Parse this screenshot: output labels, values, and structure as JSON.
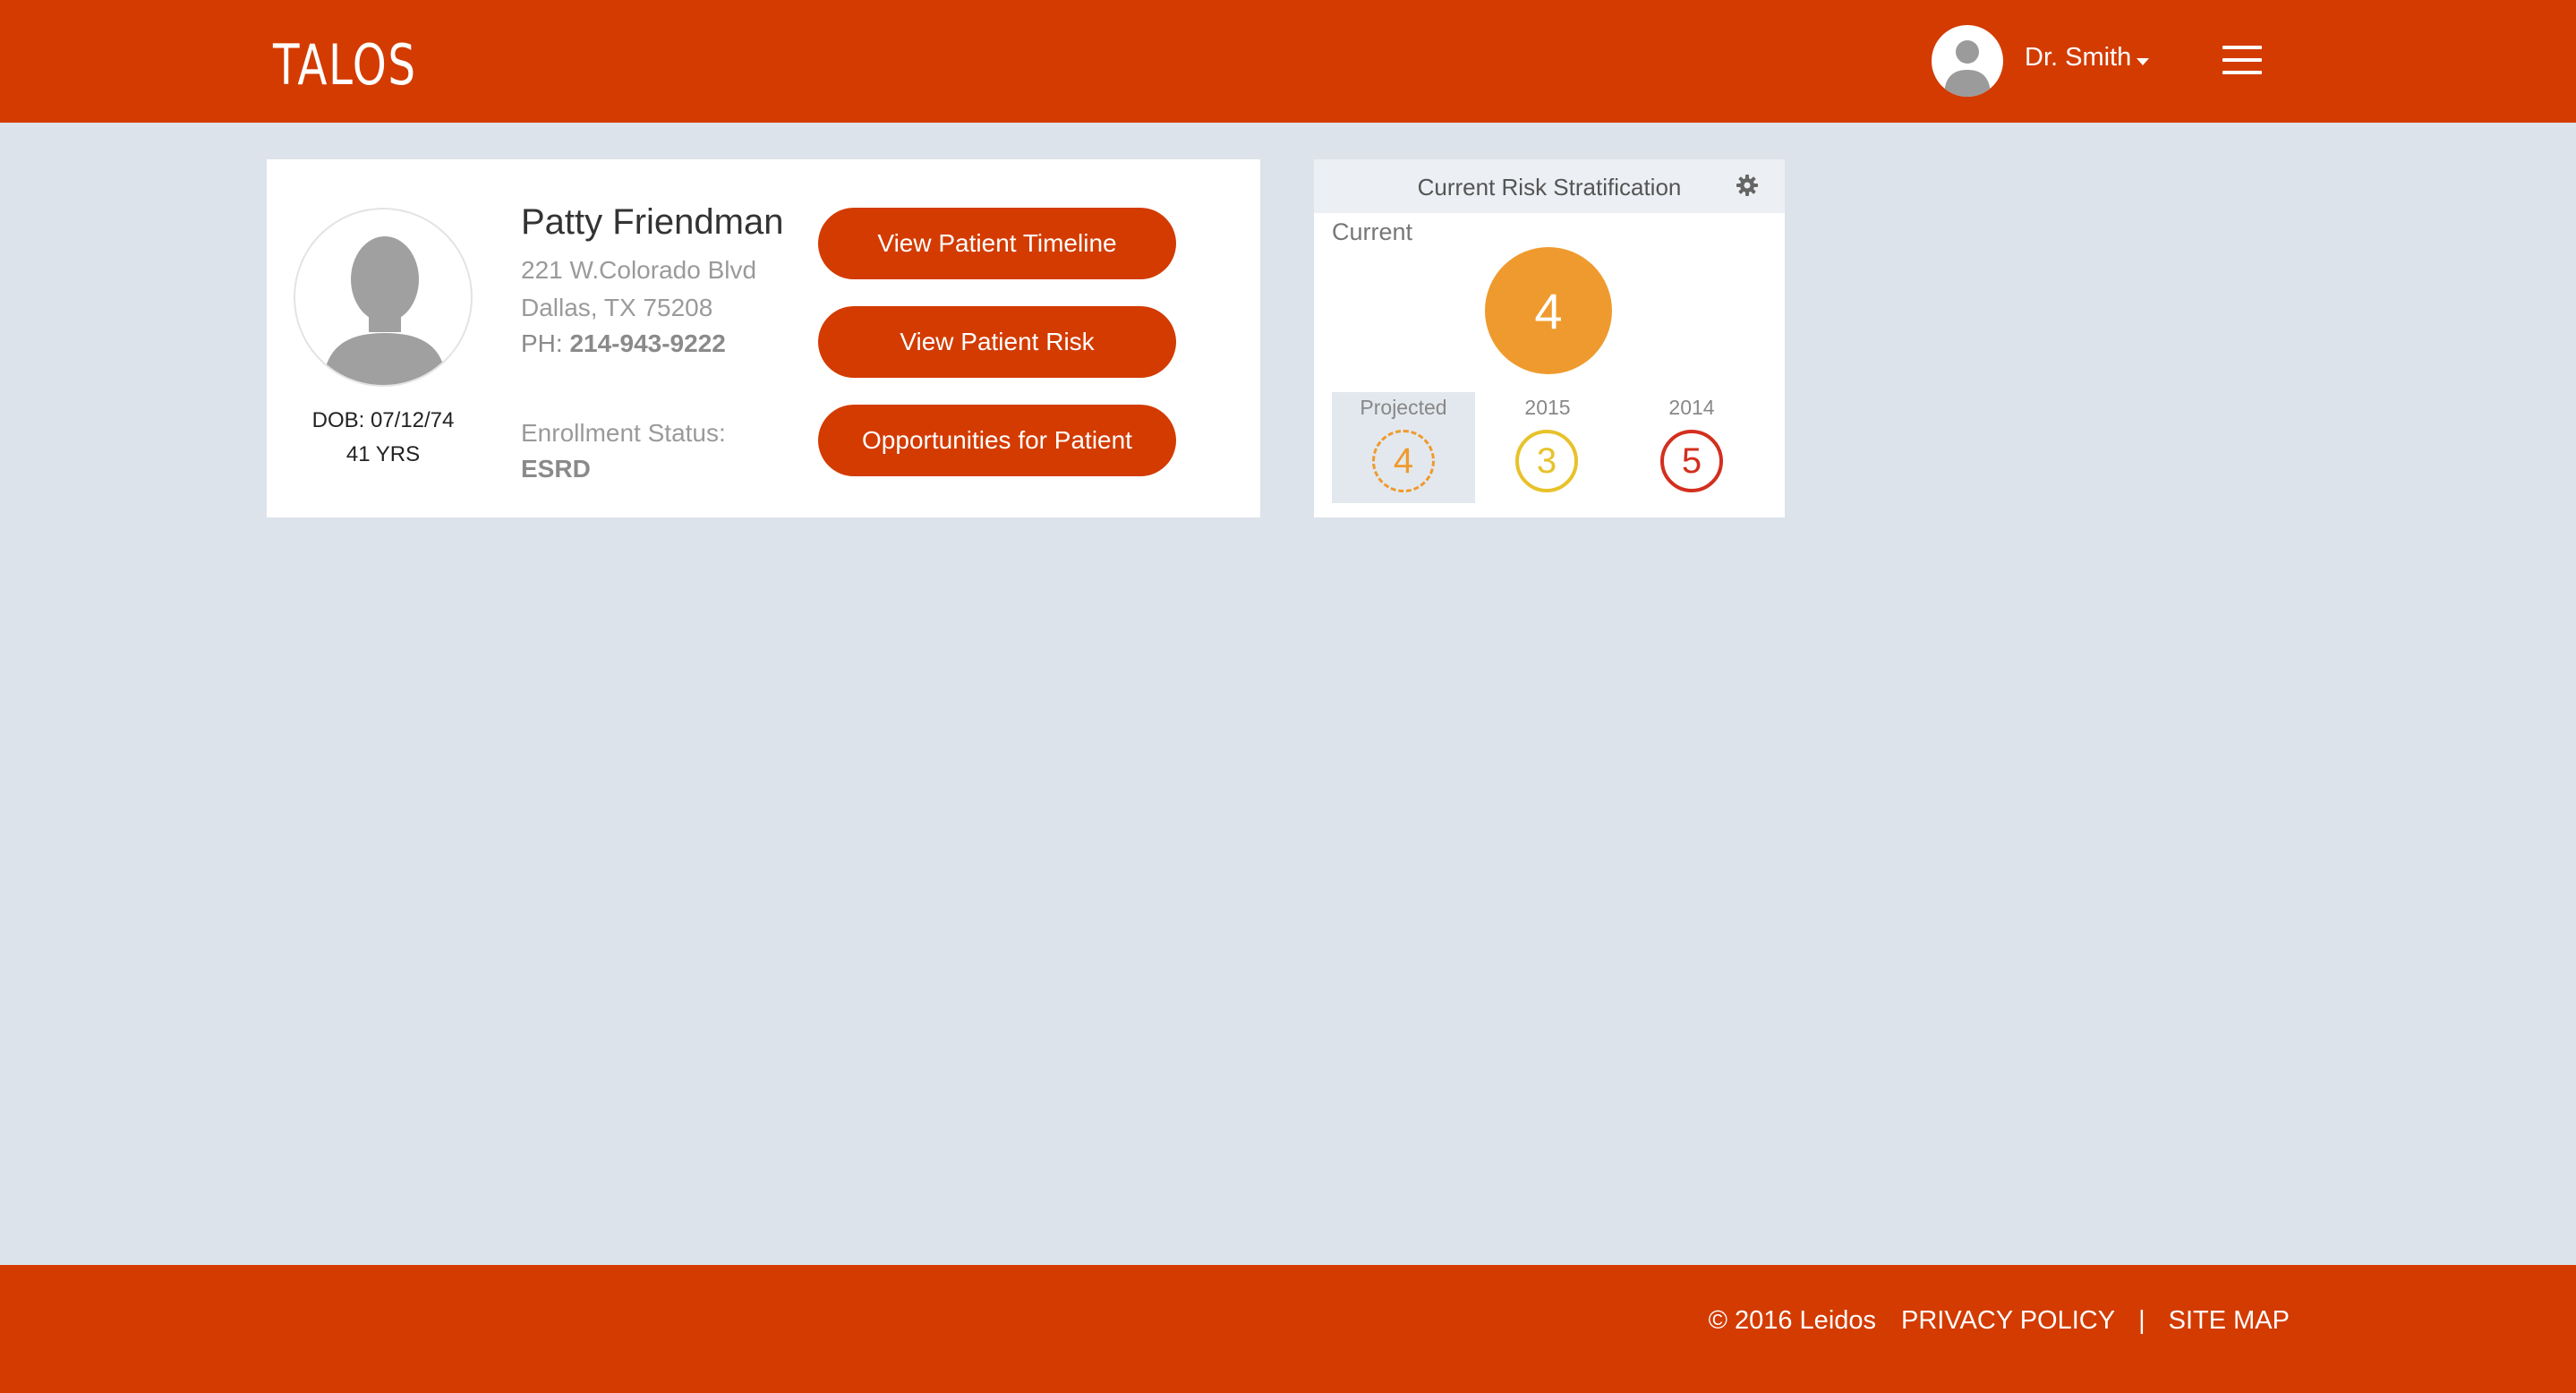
{
  "header": {
    "logo": "TALOS",
    "user_name": "Dr. Smith",
    "brand_color": "#d33b00"
  },
  "patient": {
    "name": "Patty Friendman",
    "address_line1": "221 W.Colorado Blvd",
    "address_line2": "Dallas, TX 75208",
    "phone_label": "PH:",
    "phone_number": "214-943-9222",
    "dob": "DOB: 07/12/74",
    "age": "41 YRS",
    "enrollment_label": "Enrollment Status:",
    "enrollment_value": "ESRD",
    "buttons": [
      {
        "label": "View Patient Timeline"
      },
      {
        "label": "View Patient Risk"
      },
      {
        "label": "Opportunities for Patient"
      }
    ]
  },
  "risk": {
    "title": "Current Risk Stratification",
    "current_label": "Current",
    "current_score": "4",
    "columns": [
      {
        "label": "Projected",
        "score": "4",
        "color": "#ef9a2e"
      },
      {
        "label": "2015",
        "score": "3",
        "color": "#e8c22a"
      },
      {
        "label": "2014",
        "score": "5",
        "color": "#d32f1e"
      }
    ]
  },
  "footer": {
    "copyright": "© 2016 Leidos",
    "privacy": "PRIVACY POLICY",
    "separator": "|",
    "sitemap": "SITE MAP"
  }
}
